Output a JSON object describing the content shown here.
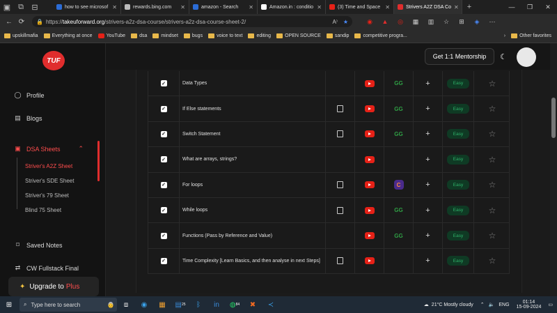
{
  "browser": {
    "tabs": [
      {
        "label": "how to see microsof",
        "color": "#2b6cd6"
      },
      {
        "label": "rewards.bing.com",
        "color": "#bbbbbb"
      },
      {
        "label": "amazon - Search",
        "color": "#2b6cd6"
      },
      {
        "label": "Amazon.in : conditio",
        "color": "#ffffff"
      },
      {
        "label": "(3) Time and Space",
        "color": "#e62117"
      },
      {
        "label": "Strivers A2Z DSA Co",
        "color": "#e02d2d"
      }
    ],
    "url_prefix": "https://",
    "url_domain": "takeuforward.org",
    "url_path": "/strivers-a2z-dsa-course/strivers-a2z-dsa-course-sheet-2/"
  },
  "bookmarks": [
    {
      "label": "upskillmafia",
      "icon": "folder"
    },
    {
      "label": "Everything at once",
      "icon": "folder"
    },
    {
      "label": "YouTube",
      "icon": "youtube"
    },
    {
      "label": "dsa",
      "icon": "folder"
    },
    {
      "label": "mindset",
      "icon": "folder"
    },
    {
      "label": "bugs",
      "icon": "folder"
    },
    {
      "label": "voice to text",
      "icon": "folder"
    },
    {
      "label": "editing",
      "icon": "folder"
    },
    {
      "label": "OPEN SOURCE",
      "icon": "folder"
    },
    {
      "label": "sandip",
      "icon": "folder"
    },
    {
      "label": "competitive progra...",
      "icon": "folder"
    }
  ],
  "other_favorites": "Other favorites",
  "site": {
    "logo": "TUF",
    "mentorship_button": "Get 1:1 Mentorship",
    "sidebar": {
      "profile": "Profile",
      "blogs": "Blogs",
      "dsa_sheets": "DSA Sheets",
      "sheets": [
        "Striver's A2Z Sheet",
        "Striver's SDE Sheet",
        "Striver's 79 Sheet",
        "Blind 75 Sheet"
      ],
      "saved_notes": "Saved Notes",
      "cw_fullstack": "CW Fullstack Final",
      "upgrade": "Upgrade to",
      "upgrade_plus": "Plus"
    }
  },
  "problems": [
    {
      "name": "Data Types",
      "article": false,
      "youtube": true,
      "practice": "gfg",
      "difficulty": "Easy"
    },
    {
      "name": "If Else statements",
      "article": true,
      "youtube": true,
      "practice": "gfg",
      "difficulty": "Easy"
    },
    {
      "name": "Switch Statement",
      "article": true,
      "youtube": true,
      "practice": "gfg",
      "difficulty": "Easy"
    },
    {
      "name": "What are arrays, strings?",
      "article": false,
      "youtube": true,
      "practice": "",
      "difficulty": "Easy"
    },
    {
      "name": "For loops",
      "article": true,
      "youtube": true,
      "practice": "codingninjas",
      "difficulty": "Easy"
    },
    {
      "name": "While loops",
      "article": true,
      "youtube": true,
      "practice": "gfg",
      "difficulty": "Easy"
    },
    {
      "name": "Functions (Pass by Reference and Value)",
      "article": false,
      "youtube": true,
      "practice": "gfg",
      "difficulty": "Easy"
    },
    {
      "name": "Time Complexity [Learn Basics, and then analyse in next Steps]",
      "article": true,
      "youtube": true,
      "practice": "",
      "difficulty": "Easy"
    }
  ],
  "icons": {
    "gfg": "GG",
    "codingninjas": "C"
  },
  "taskbar": {
    "search_placeholder": "Type here to search",
    "weather": "21°C  Mostly cloudy",
    "lang": "ENG",
    "time": "01:14",
    "date": "15-09-2024",
    "badge_widgets": "25",
    "badge_whatsapp": "84"
  }
}
